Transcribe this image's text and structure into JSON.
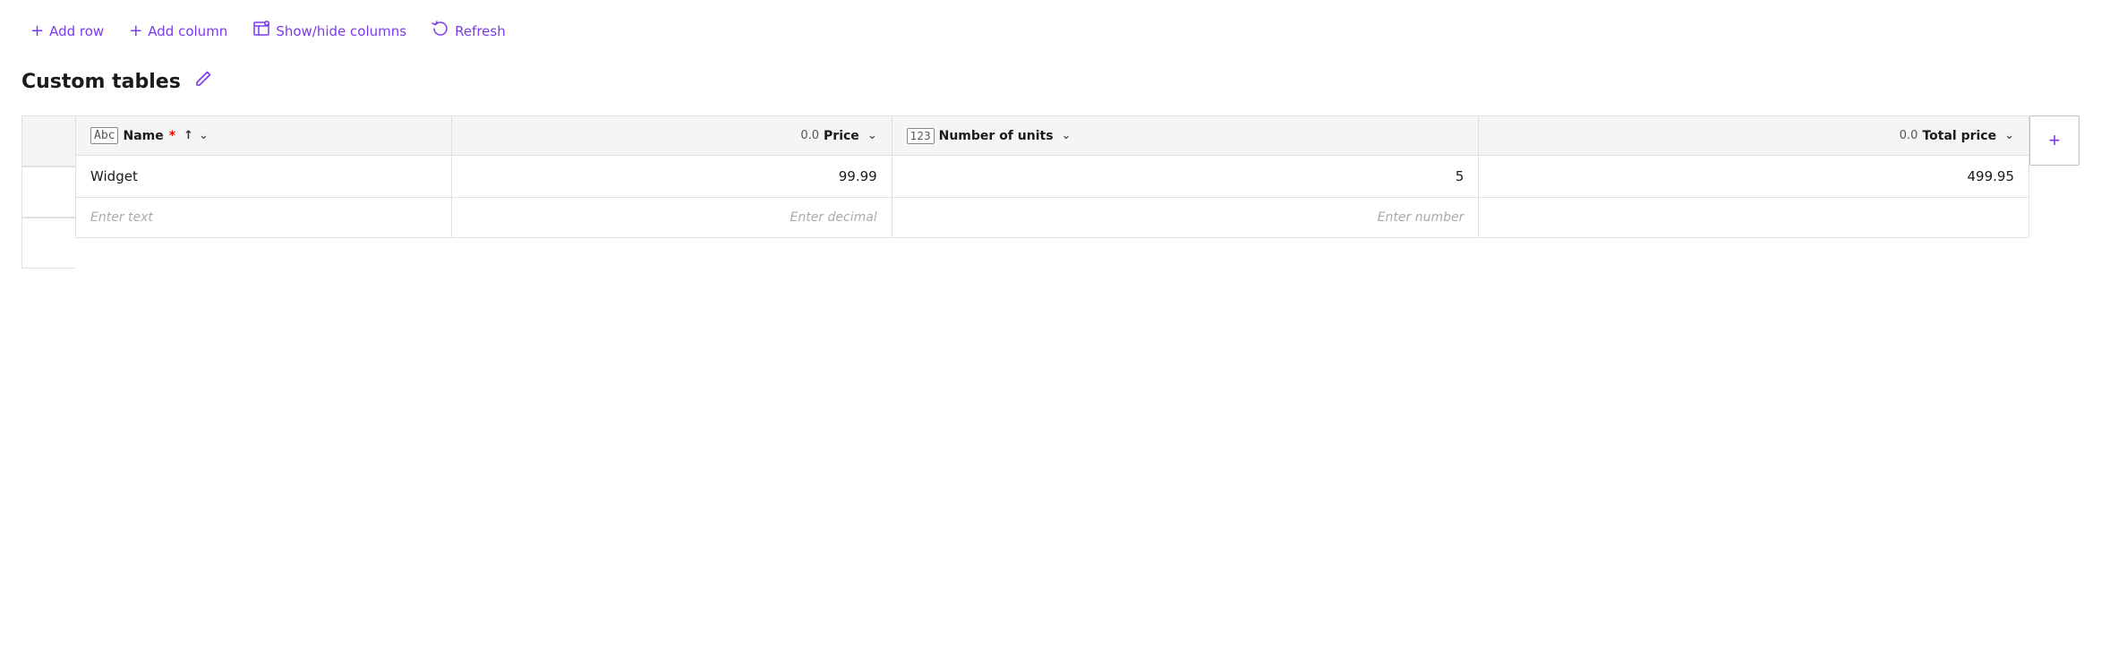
{
  "toolbar": {
    "add_row_label": "Add row",
    "add_column_label": "Add column",
    "show_hide_label": "Show/hide columns",
    "refresh_label": "Refresh"
  },
  "page": {
    "title": "Custom tables",
    "edit_icon": "✏"
  },
  "table": {
    "columns": [
      {
        "id": "name",
        "icon_type": "abc",
        "label": "Name",
        "required": true,
        "sort": "asc",
        "has_chevron": true
      },
      {
        "id": "price",
        "icon_type": "decimal",
        "icon_text": "0.0",
        "label": "Price",
        "has_chevron": true
      },
      {
        "id": "units",
        "icon_type": "number",
        "icon_text": "123",
        "label": "Number of units",
        "has_chevron": true
      },
      {
        "id": "total",
        "icon_type": "decimal",
        "icon_text": "0.0",
        "label": "Total price",
        "has_chevron": true
      }
    ],
    "rows": [
      {
        "name": "Widget",
        "price": "99.99",
        "units": "5",
        "total": "499.95"
      }
    ],
    "empty_row": {
      "name_placeholder": "Enter text",
      "price_placeholder": "Enter decimal",
      "units_placeholder": "Enter number",
      "total_placeholder": ""
    },
    "add_col_icon": "+"
  }
}
